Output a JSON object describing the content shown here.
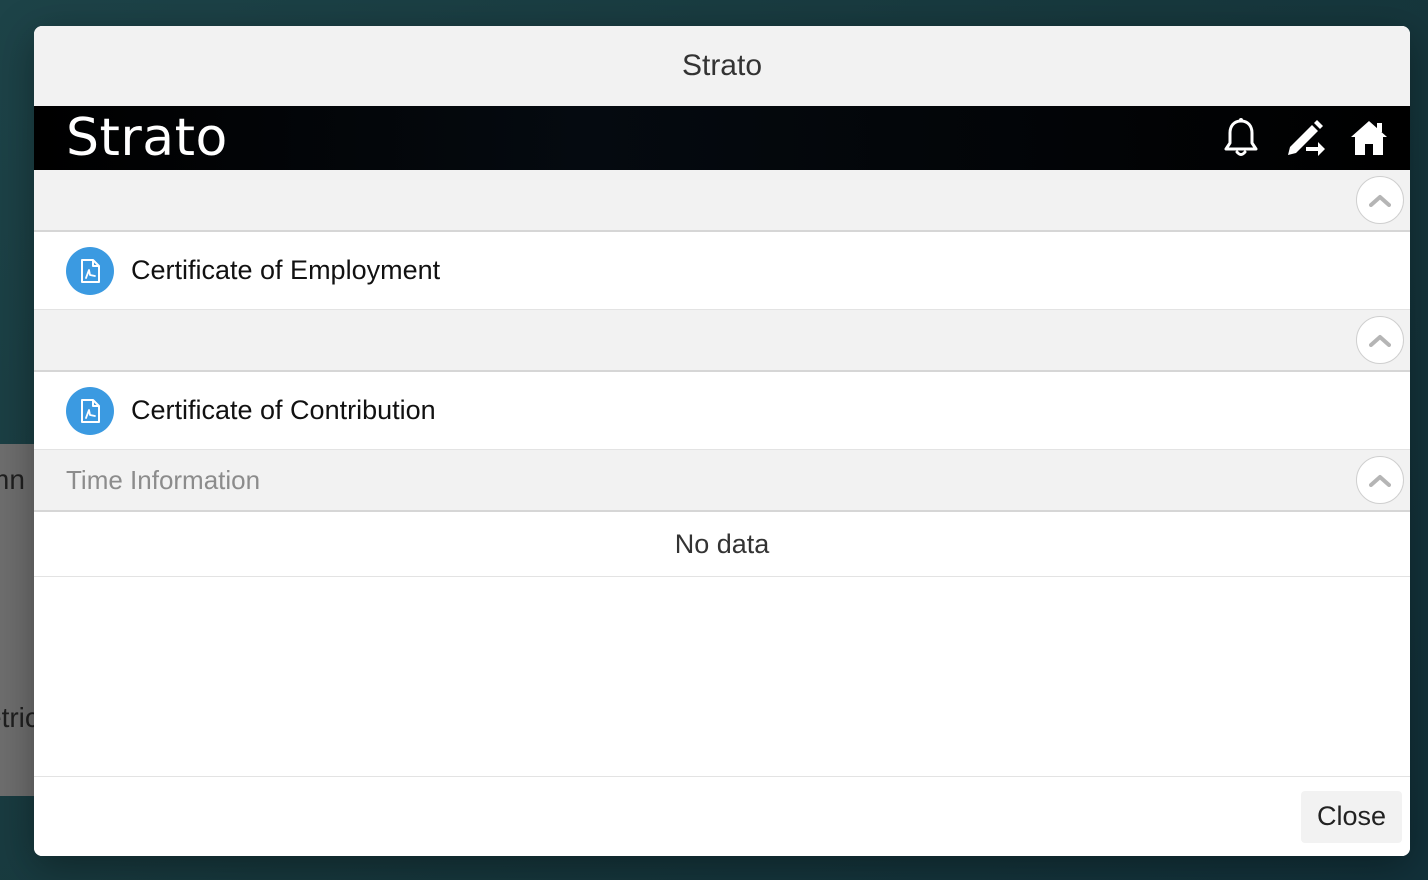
{
  "background": {
    "text_fragment_1": "mn",
    "text_fragment_2": "etric"
  },
  "dialog": {
    "title": "Strato"
  },
  "shell": {
    "brand": "Strato",
    "icons": [
      "bell-icon",
      "edit-icon",
      "home-icon"
    ]
  },
  "groups": [
    {
      "title": "",
      "items": [
        {
          "label": "Certificate of Employment",
          "icon": "pdf-document-icon"
        }
      ]
    },
    {
      "title": "",
      "items": [
        {
          "label": "Certificate of Contribution",
          "icon": "pdf-document-icon"
        }
      ]
    },
    {
      "title": "Time Information",
      "empty_text": "No data"
    }
  ],
  "footer": {
    "close_label": "Close"
  },
  "colors": {
    "accent": "#3b9ae1",
    "shell_bg": "#000000",
    "group_bg": "#f2f2f2"
  }
}
